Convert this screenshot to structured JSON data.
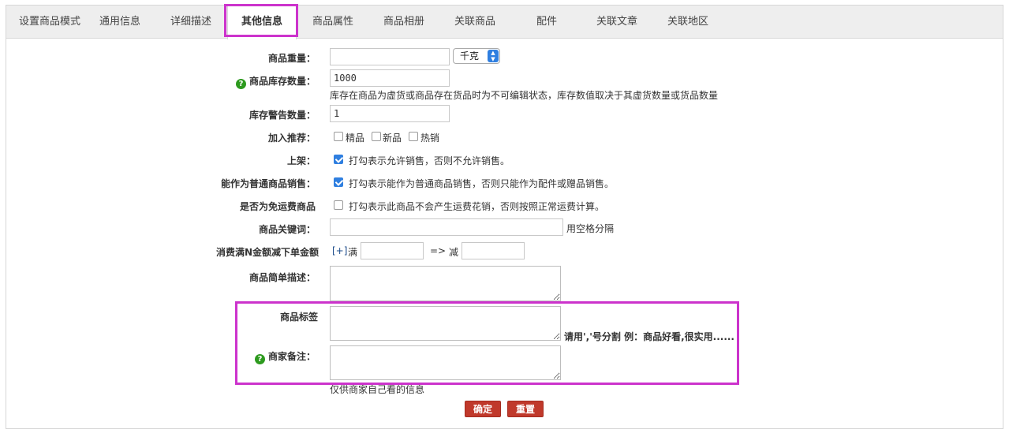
{
  "tabs": [
    {
      "label": "设置商品模式"
    },
    {
      "label": "通用信息"
    },
    {
      "label": "详细描述"
    },
    {
      "label": "其他信息"
    },
    {
      "label": "商品属性"
    },
    {
      "label": "商品相册"
    },
    {
      "label": "关联商品"
    },
    {
      "label": "配件"
    },
    {
      "label": "关联文章"
    },
    {
      "label": "关联地区"
    }
  ],
  "active_tab": "其他信息",
  "form": {
    "weight": {
      "label": "商品重量：",
      "value": "",
      "unit": "千克"
    },
    "stock": {
      "label": "商品库存数量：",
      "value": "1000",
      "help": "库存在商品为虚货或商品存在货品时为不可编辑状态，库存数值取决于其虚货数量或货品数量"
    },
    "warn_stock": {
      "label": "库存警告数量：",
      "value": "1"
    },
    "recommend": {
      "label": "加入推荐：",
      "options": [
        "精品",
        "新品",
        "热销"
      ]
    },
    "on_sale": {
      "label": "上架：",
      "checked": true,
      "text": "打勾表示允许销售，否则不允许销售。"
    },
    "normal_sale": {
      "label": "能作为普通商品销售：",
      "checked": true,
      "text": "打勾表示能作为普通商品销售，否则只能作为配件或赠品销售。"
    },
    "free_shipping": {
      "label": "是否为免运费商品",
      "checked": false,
      "text": "打勾表示此商品不会产生运费花销，否则按照正常运费计算。"
    },
    "keywords": {
      "label": "商品关键词：",
      "value": "",
      "hint": "用空格分隔"
    },
    "discount": {
      "label": "消费满N金额减下单金额",
      "plus": "[+]",
      "full": "满",
      "arrow": "=>",
      "minus": "减"
    },
    "brief": {
      "label": "商品简单描述："
    },
    "tags": {
      "label": "商品标签",
      "hint": "请用','号分割  例：商品好看,很实用......"
    },
    "seller_note": {
      "label": "商家备注：",
      "hint": "仅供商家自己看的信息"
    }
  },
  "buttons": {
    "ok": "确定",
    "reset": "重置"
  },
  "colors": {
    "highlight": "#cc33cc",
    "button": "#c0392b",
    "checkbox": "#2f7fe0",
    "help_icon": "#2d9a1e"
  }
}
